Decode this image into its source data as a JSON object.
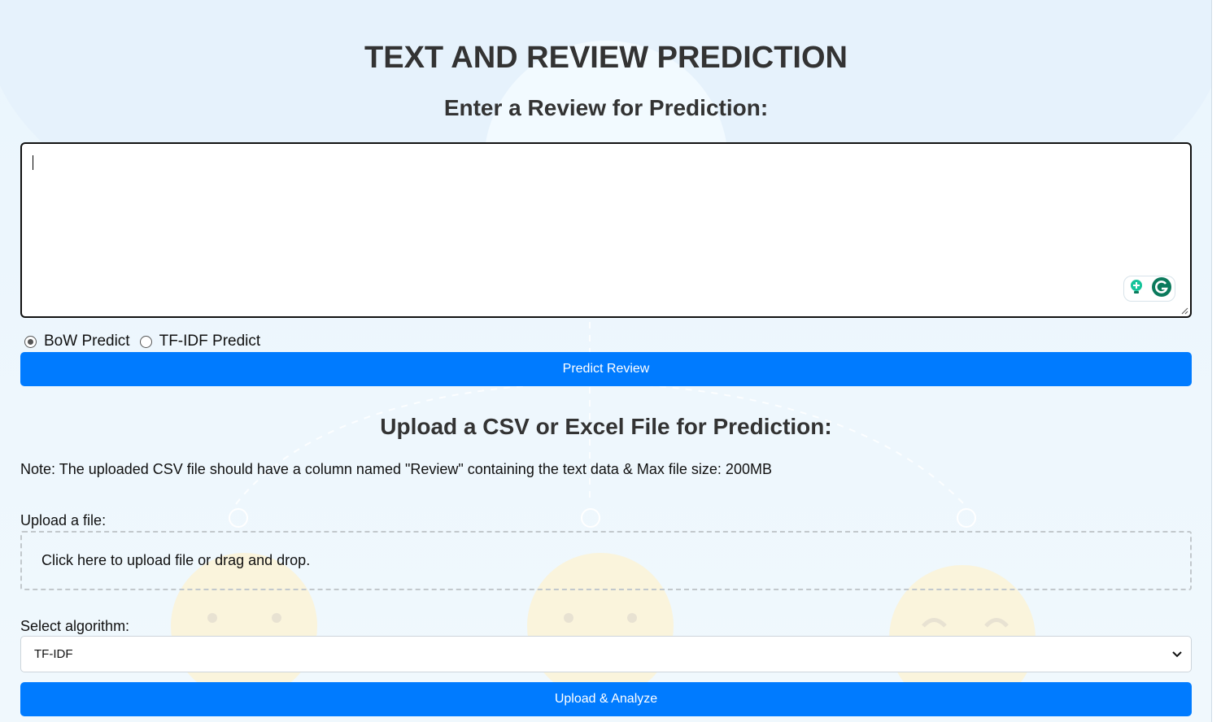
{
  "title": "TEXT AND REVIEW PREDICTION",
  "review_section": {
    "heading": "Enter a Review for Prediction:",
    "textarea_value": ""
  },
  "model_options": [
    {
      "label": "BoW Predict",
      "selected": true
    },
    {
      "label": "TF-IDF Predict",
      "selected": false
    }
  ],
  "predict_button": "Predict Review",
  "upload_section": {
    "heading": "Upload a CSV or Excel File for Prediction:",
    "note": "Note: The uploaded CSV file should have a column named \"Review\" containing the text data & Max file size: 200MB",
    "file_label": "Upload a file:",
    "dropzone_text": "Click here to upload file or drag and drop.",
    "algorithm_label": "Select algorithm:",
    "algorithm_selected": "TF-IDF",
    "analyze_button": "Upload & Analyze"
  },
  "icons": {
    "grammarly_hint": "lightbulb-icon",
    "grammarly_logo": "grammarly-g-icon",
    "select_chevron": "chevron-down-icon"
  },
  "colors": {
    "primary_button": "#007bff",
    "grammarly_green": "#15c39a",
    "grammarly_dark": "#0b7a5c"
  }
}
